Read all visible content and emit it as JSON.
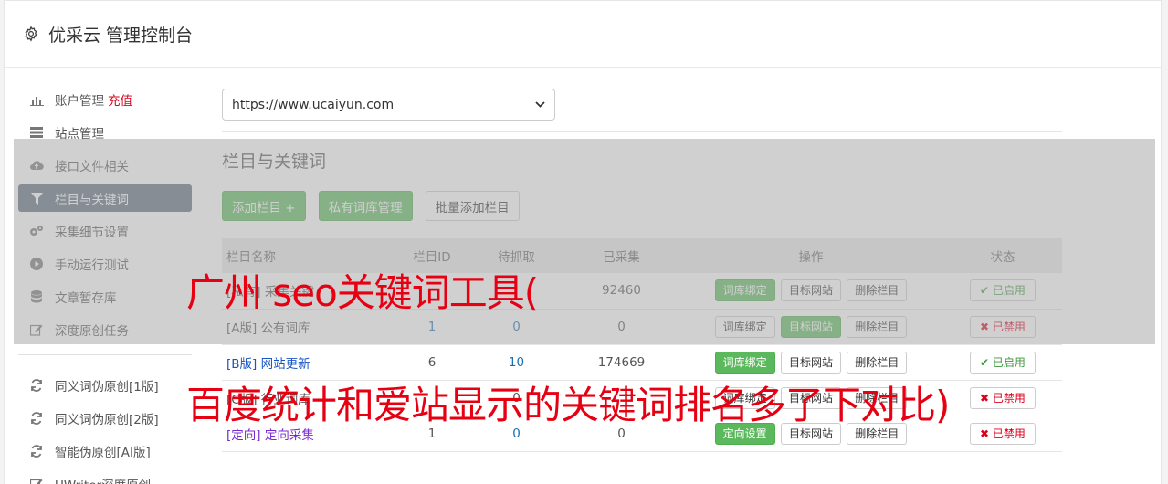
{
  "header": {
    "title": "优采云 管理控制台"
  },
  "sidebar": {
    "items": [
      {
        "label": "账户管理",
        "extra": "充值",
        "icon": "bar-chart-icon"
      },
      {
        "label": "站点管理",
        "icon": "server-icon"
      },
      {
        "label": "接口文件相关",
        "icon": "cloud-upload-icon"
      },
      {
        "label": "栏目与关键词",
        "icon": "filter-icon",
        "active": true
      },
      {
        "label": "采集细节设置",
        "icon": "cogs-icon"
      },
      {
        "label": "手动运行测试",
        "icon": "play-circle-icon"
      },
      {
        "label": "文章暂存库",
        "icon": "database-icon"
      },
      {
        "label": "深度原创任务",
        "icon": "edit-icon"
      }
    ],
    "items2": [
      {
        "label": "同义词伪原创[1版]",
        "icon": "refresh-icon"
      },
      {
        "label": "同义词伪原创[2版]",
        "icon": "refresh-icon"
      },
      {
        "label": "智能伪原创[AI版]",
        "icon": "refresh-icon"
      },
      {
        "label": "UWriter深度原创",
        "icon": "edit-icon"
      }
    ]
  },
  "site_select": {
    "value": "https://www.ucaiyun.com"
  },
  "section": {
    "title": "栏目与关键词",
    "add_column": "添加栏目 +",
    "private_lib": "私有词库管理",
    "batch_add": "批量添加栏目"
  },
  "table": {
    "headers": [
      "栏目名称",
      "栏目ID",
      "待抓取",
      "已采集",
      "操作",
      "状态"
    ],
    "rows": [
      {
        "name": "[私有] 采集关键",
        "id": "",
        "pending": "",
        "collected": "92460",
        "op1": "词库绑定",
        "op2": "目标网站",
        "op3": "删除栏目",
        "status": "已启用"
      },
      {
        "name": "[A版] 公有词库",
        "id": "1",
        "pending": "0",
        "collected": "0",
        "op1": "词库绑定",
        "op2": "目标网站",
        "op3": "删除栏目",
        "status": "已禁用"
      },
      {
        "name": "[B版] 网站更新",
        "id": "6",
        "pending": "10",
        "collected": "174669",
        "op1": "词库绑定",
        "op2": "目标网站",
        "op3": "删除栏目",
        "status": "已启用"
      },
      {
        "name": "[C版] 行业词库",
        "id": "",
        "pending": "0",
        "collected": "",
        "op1": "词库绑定",
        "op2": "目标网站",
        "op3": "删除栏目",
        "status": "已禁用"
      },
      {
        "name": "[定向] 定向采集",
        "id": "1",
        "pending": "0",
        "collected": "0",
        "op1": "定向设置",
        "op2": "目标网站",
        "op3": "删除栏目",
        "status": "已禁用"
      }
    ]
  },
  "overlay_text": {
    "line1": "广州 seo关键词工具(",
    "line2": "百度统计和爱站显示的关键词排名多了下对比)"
  }
}
